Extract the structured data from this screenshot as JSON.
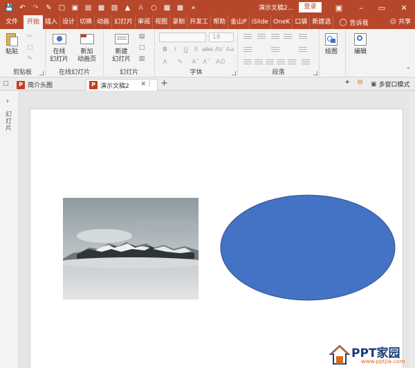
{
  "titlebar": {
    "document_title": "演示文稿2...",
    "login_label": "登录",
    "bg_color": "#b7472a"
  },
  "tabs": [
    {
      "label": "文件"
    },
    {
      "label": "开始",
      "active": true
    },
    {
      "label": "插入"
    },
    {
      "label": "设计"
    },
    {
      "label": "切换"
    },
    {
      "label": "动画"
    },
    {
      "label": "幻灯片"
    },
    {
      "label": "审阅"
    },
    {
      "label": "视图"
    },
    {
      "label": "录制"
    },
    {
      "label": "开发工"
    },
    {
      "label": "帮助"
    },
    {
      "label": "金山P"
    },
    {
      "label": "iSlide"
    },
    {
      "label": "OneK"
    },
    {
      "label": "口袋"
    },
    {
      "label": "新建选"
    }
  ],
  "tell_me": "告诉我",
  "share_label": "共享",
  "ribbon": {
    "clipboard": {
      "paste_label": "粘贴",
      "group_label": "剪贴板"
    },
    "online_slides": {
      "online_label": "在线\n幻灯片",
      "new_anim_label": "新加\n动画页",
      "group_label": "在线幻灯片"
    },
    "slides": {
      "new_slide_label": "新建\n幻灯片",
      "group_label": "幻灯片"
    },
    "font": {
      "size_value": "18",
      "group_label": "字体"
    },
    "paragraph": {
      "group_label": "段落"
    },
    "drawing": {
      "label": "绘图"
    },
    "editing": {
      "label": "编辑"
    }
  },
  "document_tabs": [
    {
      "label": "简介头图"
    },
    {
      "label": "演示文稿2",
      "active": true
    }
  ],
  "multi_window_label": "多窗口模式",
  "left_pane_label": "幻灯片",
  "slide": {
    "ellipse_color": "#4472c4",
    "ellipse_stroke": "#2f528f"
  },
  "watermark": {
    "brand": "PPT家园",
    "url": "www.pptjia.com"
  }
}
